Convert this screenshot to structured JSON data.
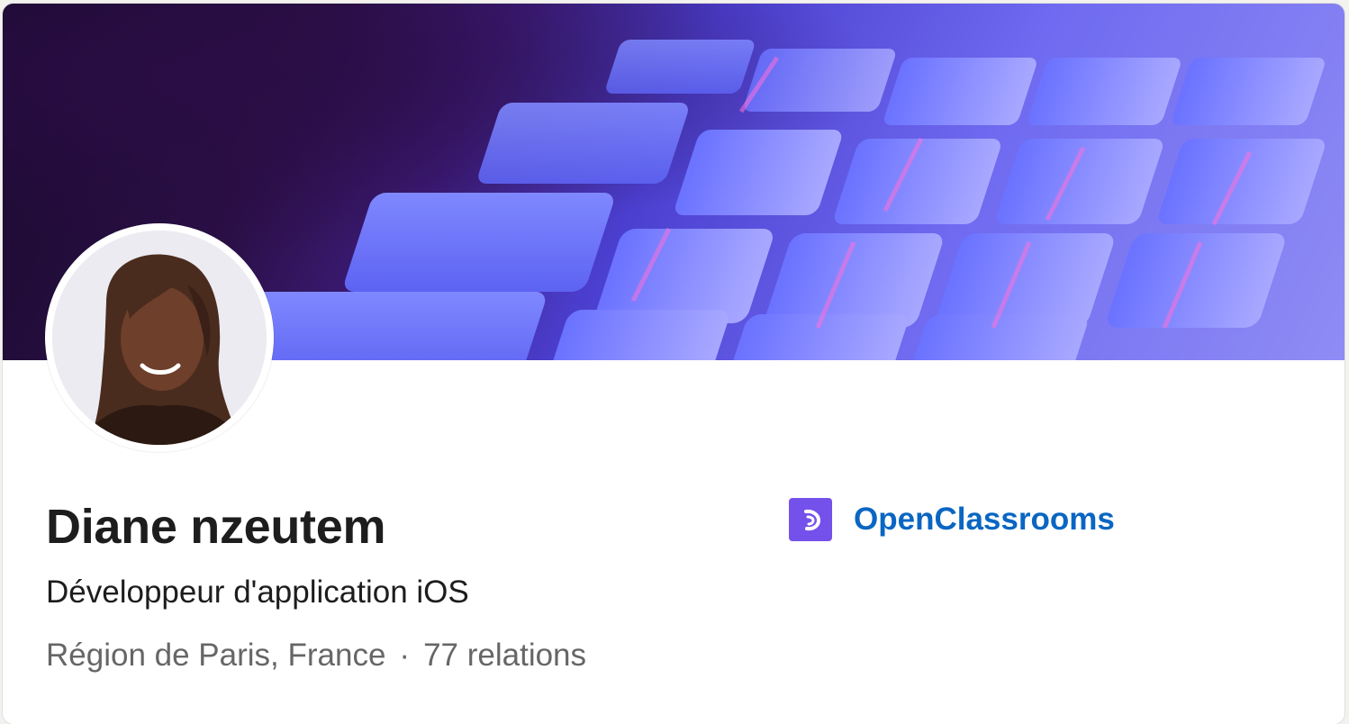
{
  "profile": {
    "name": "Diane nzeutem",
    "headline": "Développeur d'application iOS",
    "location": "Région de Paris, France",
    "separator": "·",
    "connections": "77 relations"
  },
  "company": {
    "name": "OpenClassrooms",
    "logo_icon": "openclassrooms-logo-icon",
    "logo_color": "#7451eb",
    "link_color": "#0a66c2"
  },
  "banner": {
    "description_icon": "keyboard-banner-image",
    "colors": [
      "#1a0a2e",
      "#4b3fd0",
      "#8f8cf5"
    ]
  }
}
